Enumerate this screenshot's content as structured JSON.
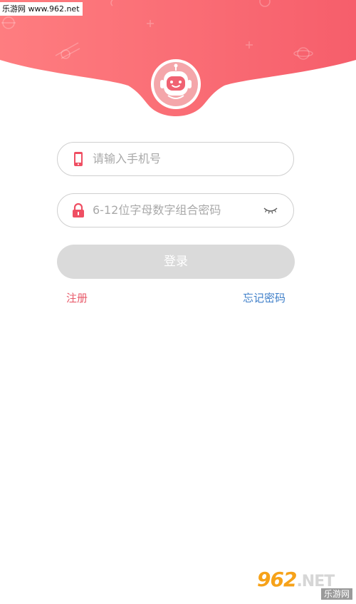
{
  "watermark": {
    "top_text": "乐游网 www.962.net",
    "logo_number": "962",
    "logo_suffix": ".NET",
    "sub_text": "乐游网"
  },
  "header": {
    "gradient_start": "#fe7b7e",
    "gradient_end": "#f8606e",
    "avatar_icon": "robot-astronaut-icon"
  },
  "form": {
    "phone": {
      "placeholder": "请输入手机号",
      "icon": "phone-icon"
    },
    "password": {
      "placeholder": "6-12位字母数字组合密码",
      "icon": "lock-icon",
      "toggle_icon": "eye-closed-icon"
    },
    "login_label": "登录",
    "register_label": "注册",
    "forgot_label": "忘记密码"
  },
  "colors": {
    "accent": "#ef4f63",
    "login_disabled": "#dadada",
    "link_blue": "#3f7fc9",
    "link_red": "#e85a6a"
  }
}
